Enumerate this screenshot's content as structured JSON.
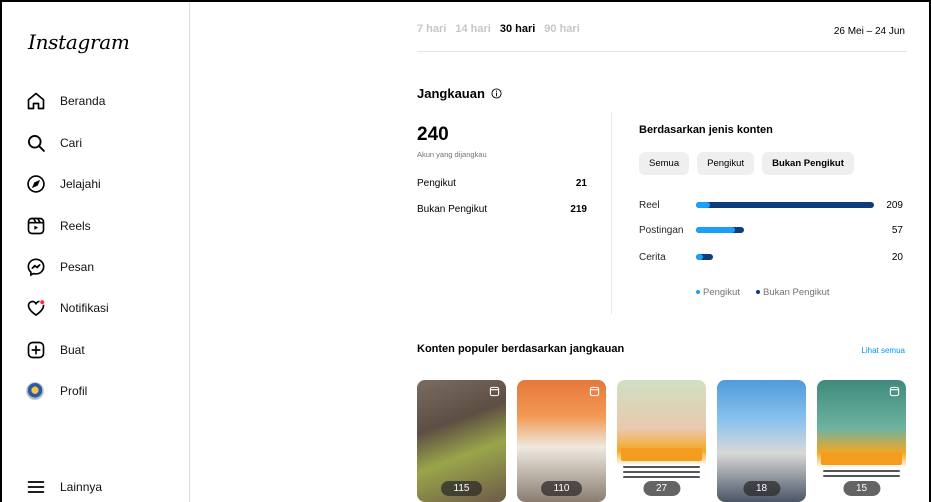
{
  "app": {
    "logo": "Instagram"
  },
  "sidebar": {
    "items": [
      {
        "label": "Beranda",
        "icon": "home-icon"
      },
      {
        "label": "Cari",
        "icon": "search-icon"
      },
      {
        "label": "Jelajahi",
        "icon": "explore-icon"
      },
      {
        "label": "Reels",
        "icon": "reels-icon"
      },
      {
        "label": "Pesan",
        "icon": "messenger-icon"
      },
      {
        "label": "Notifikasi",
        "icon": "heart-icon"
      },
      {
        "label": "Buat",
        "icon": "plus-square-icon"
      },
      {
        "label": "Profil",
        "icon": "avatar"
      }
    ],
    "more": {
      "label": "Lainnya",
      "icon": "menu-icon"
    }
  },
  "periods": [
    {
      "label": "7 hari",
      "active": false
    },
    {
      "label": "14 hari",
      "active": false
    },
    {
      "label": "30 hari",
      "active": true
    },
    {
      "label": "90 hari",
      "active": false
    }
  ],
  "date_range": "26 Mei – 24 Jun",
  "reach": {
    "title": "Jangkauan",
    "total": "240",
    "total_label": "Akun yang dijangkau",
    "rows": [
      {
        "label": "Pengikut",
        "value": "21"
      },
      {
        "label": "Bukan Pengikut",
        "value": "219"
      }
    ]
  },
  "content_type": {
    "title": "Berdasarkan jenis konten",
    "chips": [
      "Semua",
      "Pengikut",
      "Bukan Pengikut"
    ],
    "rows": [
      {
        "label": "Reel",
        "value": "209",
        "follower_frac": 0.08,
        "total_frac": 1.0
      },
      {
        "label": "Postingan",
        "value": "57",
        "follower_frac": 0.22,
        "total_frac": 0.27
      },
      {
        "label": "Cerita",
        "value": "20",
        "follower_frac": 0.04,
        "total_frac": 0.096
      }
    ],
    "legend": [
      "Pengikut",
      "Bukan Pengikut"
    ],
    "colors": {
      "follower": "#1ca0f5",
      "non_follower": "#0f3c7a"
    }
  },
  "popular": {
    "title": "Konten populer berdasarkan jangkauan",
    "see_all": "Lihat semua",
    "items": [
      {
        "count": "115"
      },
      {
        "count": "110"
      },
      {
        "count": "27"
      },
      {
        "count": "18"
      },
      {
        "count": "15"
      }
    ]
  }
}
